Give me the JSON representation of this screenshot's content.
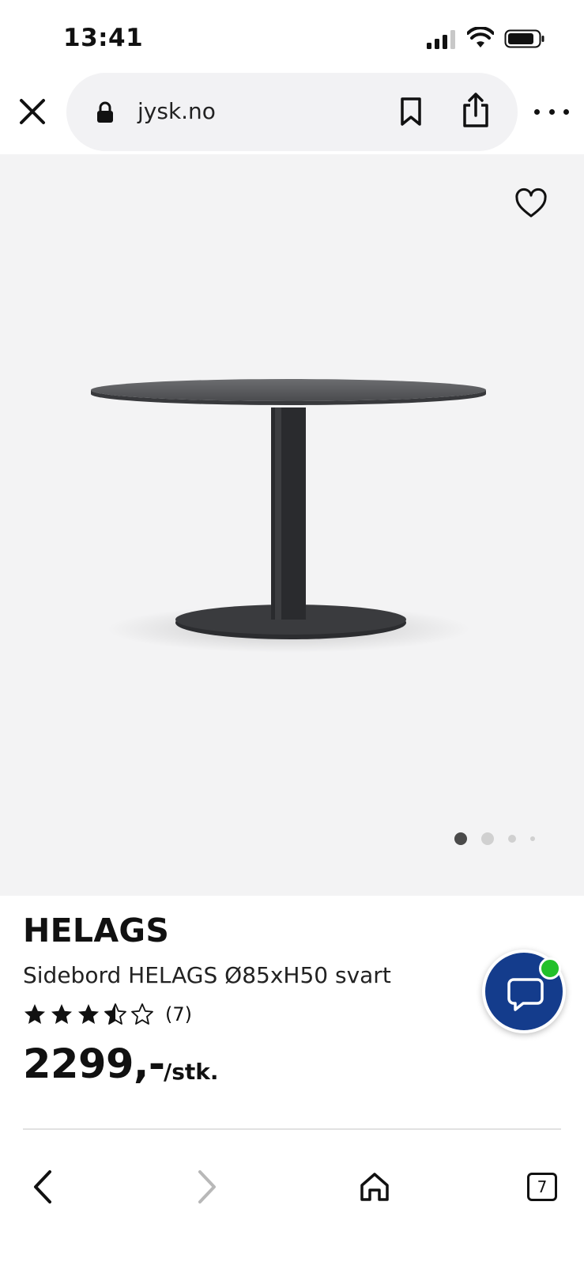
{
  "status_bar": {
    "time": "13:41"
  },
  "browser": {
    "url": "jysk.no",
    "tabs_count": "7"
  },
  "product": {
    "brand": "HELAGS",
    "name": "Sidebord HELAGS Ø85xH50 svart",
    "rating": 3.5,
    "rating_max": 5,
    "review_count": "(7)",
    "price": "2299,-",
    "unit": "/stk.",
    "image_index": 1,
    "image_count": 4
  },
  "colors": {
    "chat_button": "#143c8c",
    "online_indicator": "#22c02a",
    "image_bg": "#f3f3f4"
  }
}
